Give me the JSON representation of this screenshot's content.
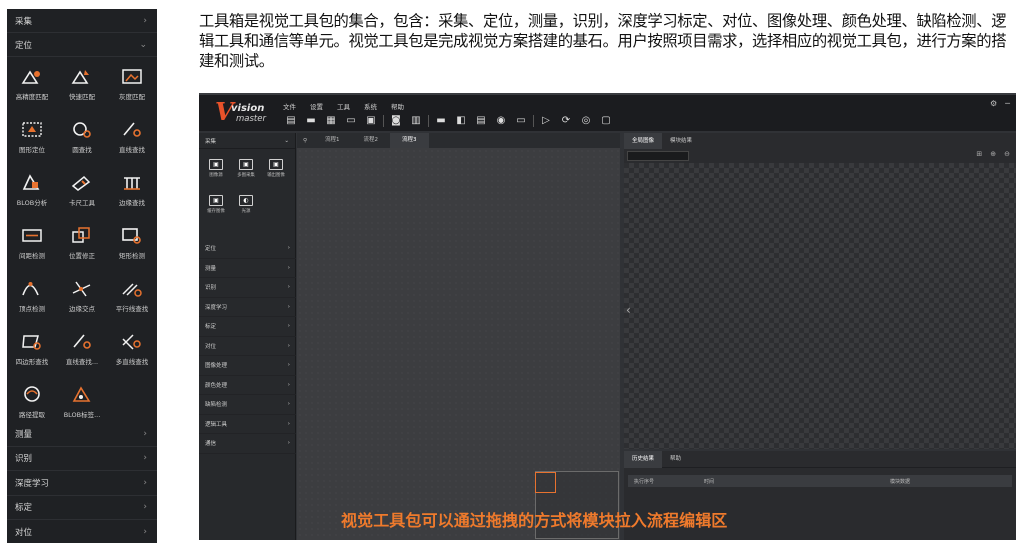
{
  "toolbox": {
    "top_category": "采集",
    "open_category": "定位",
    "tools": [
      {
        "label": "高精度匹配",
        "icon": "high-precision-match-icon"
      },
      {
        "label": "快速匹配",
        "icon": "fast-match-icon"
      },
      {
        "label": "灰度匹配",
        "icon": "gray-match-icon"
      },
      {
        "label": "图形定位",
        "icon": "shape-locate-icon"
      },
      {
        "label": "圆查找",
        "icon": "circle-find-icon"
      },
      {
        "label": "直线查找",
        "icon": "line-find-icon"
      },
      {
        "label": "BLOB分析",
        "icon": "blob-analysis-icon"
      },
      {
        "label": "卡尺工具",
        "icon": "caliper-icon"
      },
      {
        "label": "边缘查找",
        "icon": "edge-find-icon"
      },
      {
        "label": "间距检测",
        "icon": "spacing-detect-icon"
      },
      {
        "label": "位置修正",
        "icon": "position-correct-icon"
      },
      {
        "label": "矩形检测",
        "icon": "rect-detect-icon"
      },
      {
        "label": "顶点检测",
        "icon": "vertex-detect-icon"
      },
      {
        "label": "边缘交点",
        "icon": "edge-intersection-icon"
      },
      {
        "label": "平行线查找",
        "icon": "parallel-line-icon"
      },
      {
        "label": "四边形查找",
        "icon": "quad-find-icon"
      },
      {
        "label": "直线查找...",
        "icon": "line-find-2-icon"
      },
      {
        "label": "多直线查找",
        "icon": "multi-line-icon"
      },
      {
        "label": "路径提取",
        "icon": "path-extract-icon"
      },
      {
        "label": "BLOB标签...",
        "icon": "blob-label-icon"
      }
    ],
    "bottom_categories": [
      "测量",
      "识别",
      "深度学习",
      "标定",
      "对位"
    ]
  },
  "description": "工具箱是视觉工具包的集合，包含：采集、定位，测量，识别，深度学习标定、对位、图像处理、颜色处理、缺陷检测、逻辑工具和通信等单元。视觉工具包是完成视觉方案搭建的基石。用户按照项目需求，选择相应的视觉工具包，进行方案的搭建和测试。",
  "app": {
    "logo_top": "vision",
    "logo_bottom": "master",
    "menus": [
      "文件",
      "设置",
      "工具",
      "系统",
      "帮助"
    ],
    "side_head": "采集",
    "side_tools": [
      {
        "label": "图像源",
        "glyph": "▣"
      },
      {
        "label": "多图采集",
        "glyph": "▣"
      },
      {
        "label": "输出图像",
        "glyph": "▣"
      },
      {
        "label": "缓存图像",
        "glyph": "▣"
      },
      {
        "label": "光源",
        "glyph": "◐"
      }
    ],
    "side_categories": [
      "定位",
      "测量",
      "识别",
      "深度学习",
      "标定",
      "对位",
      "图像处理",
      "颜色处理",
      "缺陷检测",
      "逻辑工具",
      "通信"
    ],
    "flow_tabs": [
      "流程1",
      "流程2",
      "流程3"
    ],
    "image_tabs": [
      "全局图像",
      "模块结果"
    ],
    "result_tabs": [
      "历史结果",
      "帮助"
    ],
    "result_columns": [
      "执行序号",
      "时间",
      "模块数据"
    ]
  },
  "caption": "视觉工具包可以通过拖拽的方式将模块拉入流程编辑区",
  "colors": {
    "accent": "#ef7a2c",
    "panel_bg": "#1f2124",
    "logo": "#e8522a"
  }
}
